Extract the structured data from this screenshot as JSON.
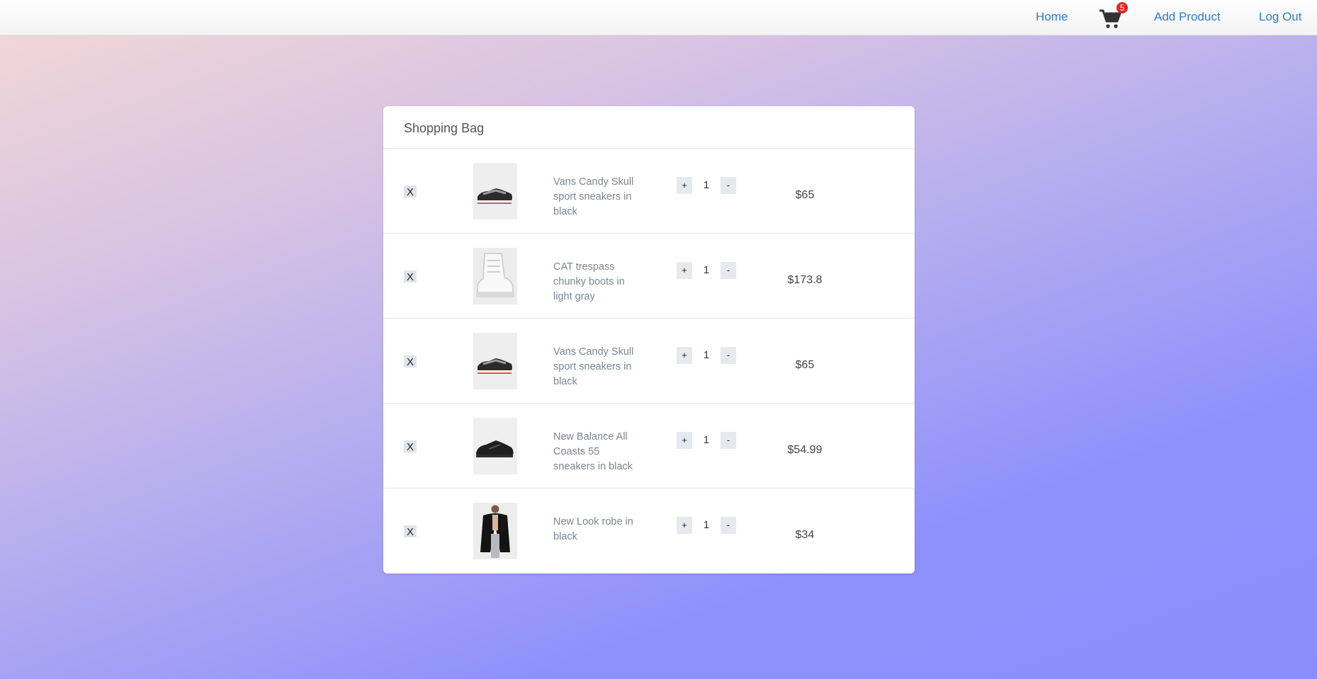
{
  "nav": {
    "home": "Home",
    "cart_count": "5",
    "add_product": "Add Product",
    "log_out": "Log Out"
  },
  "bag": {
    "title": "Shopping Bag",
    "remove_label": "X",
    "plus_label": "+",
    "minus_label": "-",
    "items": [
      {
        "name": "Vans Candy Skull sport sneakers in black",
        "qty": "1",
        "price": "$65",
        "image": "sneaker-icon"
      },
      {
        "name": "CAT trespass chunky boots in light gray",
        "qty": "1",
        "price": "$173.8",
        "image": "boot-icon"
      },
      {
        "name": "Vans Candy Skull sport sneakers in black",
        "qty": "1",
        "price": "$65",
        "image": "sneaker-icon"
      },
      {
        "name": "New Balance All Coasts 55 sneakers in black",
        "qty": "1",
        "price": "$54.99",
        "image": "black-sneaker-icon"
      },
      {
        "name": "New Look robe in black",
        "qty": "1",
        "price": "$34",
        "image": "robe-icon"
      }
    ]
  },
  "colors": {
    "link": "#2a7ad4",
    "badge": "#e52323",
    "gradient_start": "#f3d9d6",
    "gradient_end": "#8b8dfc"
  }
}
